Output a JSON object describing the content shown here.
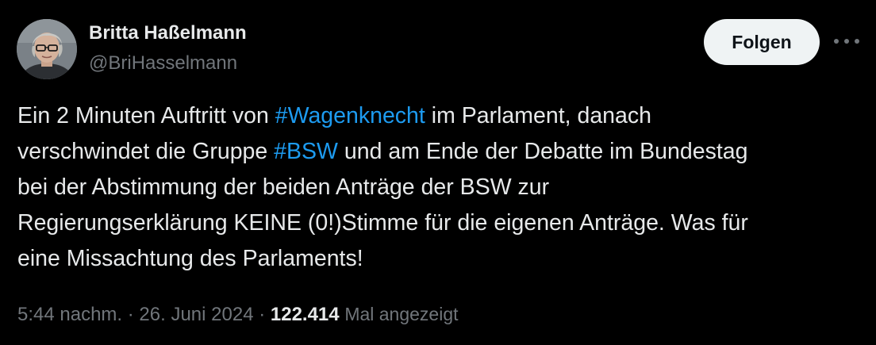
{
  "author": {
    "name": "Britta Haßelmann",
    "handle": "@BriHasselmann"
  },
  "follow_button": {
    "label": "Folgen"
  },
  "more_icon": "more-horizontal-icon",
  "tweet": {
    "lines": [
      [
        {
          "text": "Ein 2 Minuten Auftritt von "
        },
        {
          "text": "#Wagenknecht",
          "hashtag": true
        },
        {
          "text": " im Parlament, danach"
        }
      ],
      [
        {
          "text": "verschwindet die Gruppe "
        },
        {
          "text": "#BSW",
          "hashtag": true
        },
        {
          "text": " und am Ende der Debatte im Bundestag"
        }
      ],
      [
        {
          "text": "bei der Abstimmung der beiden Anträge der BSW zur"
        }
      ],
      [
        {
          "text": "Regierungserklärung KEINE (0!)Stimme für die eigenen Anträge. Was für"
        }
      ],
      [
        {
          "text": "eine Missachtung des Parlaments!"
        }
      ]
    ]
  },
  "meta": {
    "time": "5:44 nachm.",
    "separator": " · ",
    "date": "26. Juni 2024",
    "views_count": "122.414",
    "views_label": "Mal angezeigt"
  },
  "colors": {
    "background": "#000000",
    "text_primary": "#e7e9ea",
    "text_secondary": "#71767b",
    "hashtag": "#1d9bf0",
    "button_bg": "#eff3f4",
    "button_text": "#0f1419"
  }
}
